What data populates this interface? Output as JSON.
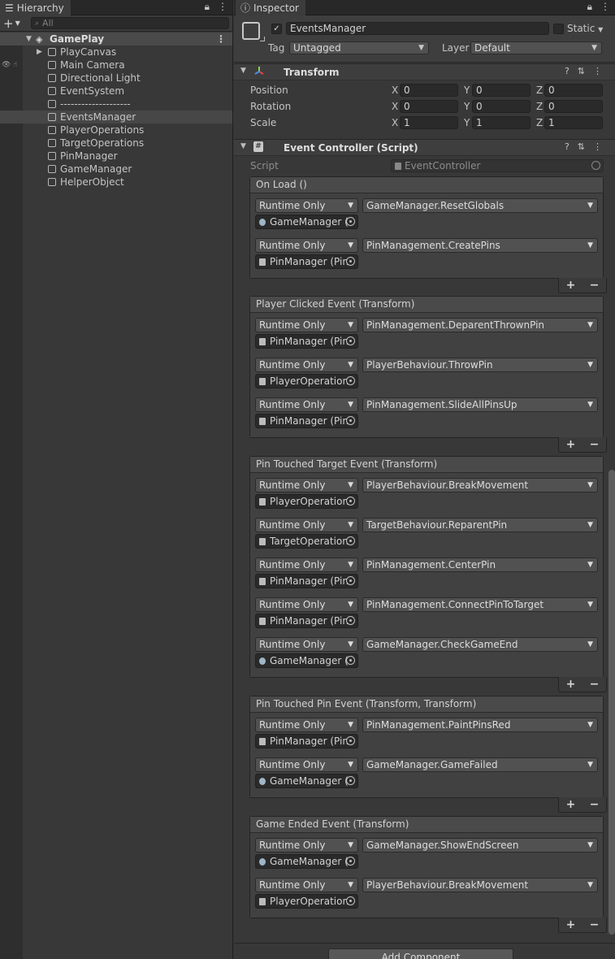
{
  "hierarchy": {
    "tab_title": "Hierarchy",
    "search_placeholder": "All",
    "scene_name": "GamePlay",
    "items": [
      "PlayCanvas",
      "Main Camera",
      "Directional Light",
      "EventSystem",
      "--------------------",
      "EventsManager",
      "PlayerOperations",
      "TargetOperations",
      "PinManager",
      "GameManager",
      "HelperObject"
    ],
    "selected": "EventsManager"
  },
  "inspector": {
    "tab_title": "Inspector",
    "object_name": "EventsManager",
    "active": true,
    "static_label": "Static",
    "tag_label": "Tag",
    "tag_value": "Untagged",
    "layer_label": "Layer",
    "layer_value": "Default",
    "transform": {
      "title": "Transform",
      "rows": [
        {
          "label": "Position",
          "x": "0",
          "y": "0",
          "z": "0"
        },
        {
          "label": "Rotation",
          "x": "0",
          "y": "0",
          "z": "0"
        },
        {
          "label": "Scale",
          "x": "1",
          "y": "1",
          "z": "1"
        }
      ]
    },
    "script_component": {
      "title": "Event Controller (Script)",
      "script_label": "Script",
      "script_value": "EventController"
    },
    "events": [
      {
        "title": "On Load ()",
        "entries": [
          {
            "mode": "Runtime Only",
            "function": "GameManager.ResetGlobals",
            "object": "GameManager (",
            "icon": "go"
          },
          {
            "mode": "Runtime Only",
            "function": "PinManagement.CreatePins",
            "object": "PinManager (Pin",
            "icon": "script"
          }
        ]
      },
      {
        "title": "Player Clicked Event (Transform)",
        "entries": [
          {
            "mode": "Runtime Only",
            "function": "PinManagement.DeparentThrownPin",
            "object": "PinManager (Pin",
            "icon": "script"
          },
          {
            "mode": "Runtime Only",
            "function": "PlayerBehaviour.ThrowPin",
            "object": "PlayerOperation",
            "icon": "script"
          },
          {
            "mode": "Runtime Only",
            "function": "PinManagement.SlideAllPinsUp",
            "object": "PinManager (Pin",
            "icon": "script"
          }
        ]
      },
      {
        "title": "Pin Touched Target Event (Transform)",
        "entries": [
          {
            "mode": "Runtime Only",
            "function": "PlayerBehaviour.BreakMovement",
            "object": "PlayerOperation",
            "icon": "script"
          },
          {
            "mode": "Runtime Only",
            "function": "TargetBehaviour.ReparentPin",
            "object": "TargetOperation",
            "icon": "script"
          },
          {
            "mode": "Runtime Only",
            "function": "PinManagement.CenterPin",
            "object": "PinManager (Pin",
            "icon": "script"
          },
          {
            "mode": "Runtime Only",
            "function": "PinManagement.ConnectPinToTarget",
            "object": "PinManager (Pin",
            "icon": "script"
          },
          {
            "mode": "Runtime Only",
            "function": "GameManager.CheckGameEnd",
            "object": "GameManager (",
            "icon": "go"
          }
        ]
      },
      {
        "title": "Pin Touched Pin Event (Transform, Transform)",
        "entries": [
          {
            "mode": "Runtime Only",
            "function": "PinManagement.PaintPinsRed",
            "object": "PinManager (Pin",
            "icon": "script"
          },
          {
            "mode": "Runtime Only",
            "function": "GameManager.GameFailed",
            "object": "GameManager (",
            "icon": "go"
          }
        ]
      },
      {
        "title": "Game Ended Event (Transform)",
        "entries": [
          {
            "mode": "Runtime Only",
            "function": "GameManager.ShowEndScreen",
            "object": "GameManager (",
            "icon": "go"
          },
          {
            "mode": "Runtime Only",
            "function": "PlayerBehaviour.BreakMovement",
            "object": "PlayerOperation",
            "icon": "script"
          }
        ]
      }
    ],
    "add_component_label": "Add Component"
  }
}
